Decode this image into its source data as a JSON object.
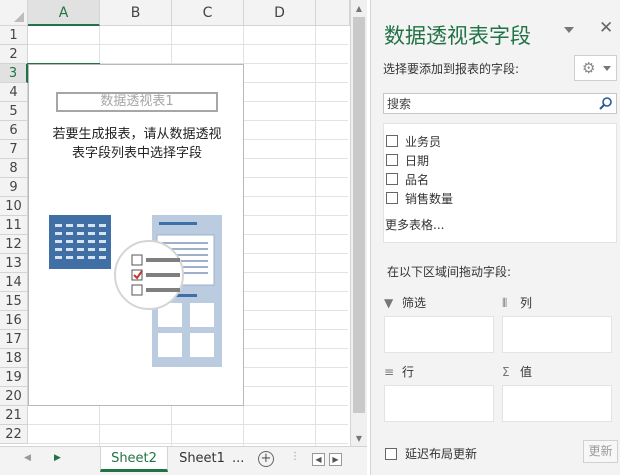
{
  "columns": [
    "A",
    "B",
    "C",
    "D"
  ],
  "rows": [
    "1",
    "2",
    "3",
    "4",
    "5",
    "6",
    "7",
    "8",
    "9",
    "10",
    "11",
    "12",
    "13",
    "14",
    "15",
    "16",
    "17",
    "18",
    "19",
    "20",
    "21",
    "22"
  ],
  "selected_column": "A",
  "selected_row": "3",
  "pivot_placeholder": {
    "title": "数据透视表1",
    "message_line1": "若要生成报表，请从数据透视",
    "message_line2": "表字段列表中选择字段"
  },
  "sheet_tabs": [
    "Sheet2",
    "Sheet1"
  ],
  "active_sheet": "Sheet2",
  "tabs_more": "...",
  "panel": {
    "title": "数据透视表字段",
    "subtitle": "选择要添加到报表的字段:",
    "search_placeholder": "搜索",
    "fields": [
      "业务员",
      "日期",
      "品名",
      "销售数量"
    ],
    "more_tables": "更多表格...",
    "drag_hint": "在以下区域间拖动字段:",
    "areas": {
      "filters": {
        "label": "筛选",
        "icon": "filter-icon"
      },
      "columns": {
        "label": "列",
        "icon": "columns-icon"
      },
      "rows": {
        "label": "行",
        "icon": "rows-icon"
      },
      "values": {
        "label": "值",
        "icon": "sigma-icon"
      }
    },
    "defer_label": "延迟布局更新",
    "update_label": "更新"
  },
  "accent_color": "#217346"
}
